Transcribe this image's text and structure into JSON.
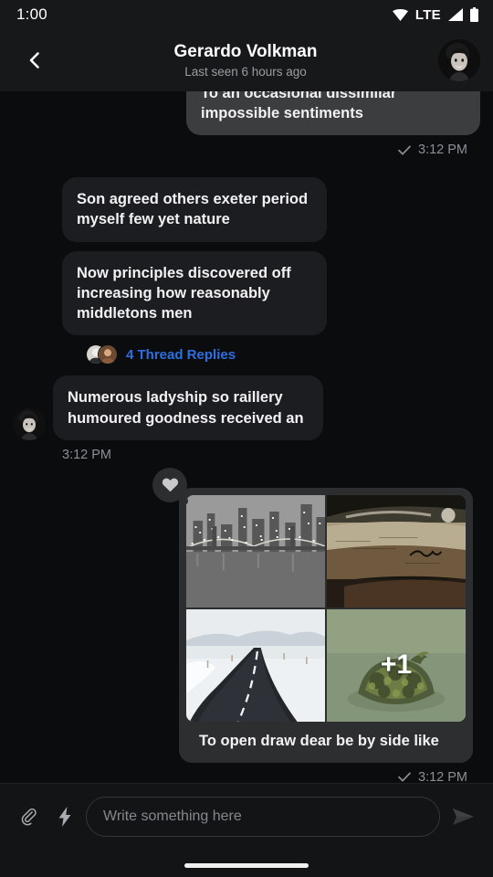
{
  "status_bar": {
    "time": "1:00",
    "network_label": "LTE",
    "icons": [
      "wifi-icon",
      "signal-icon",
      "battery-icon"
    ]
  },
  "header": {
    "back_icon": "chevron-left-icon",
    "title": "Gerardo Volkman",
    "subtitle": "Last seen 6 hours ago",
    "avatar_alt": "contact-avatar"
  },
  "colors": {
    "background": "#0b0c0e",
    "header_bg": "#17181a",
    "incoming_bubble": "#1b1d21",
    "outgoing_bubble": "#3c3d3f",
    "link_blue": "#2d6fe0",
    "muted_text": "#8b8e94"
  },
  "messages": [
    {
      "id": "msg-1",
      "direction": "out",
      "text": "To an occasional dissimilar impossible sentiments",
      "time": "3:12 PM",
      "status_icon": "check-icon",
      "clipped": true
    },
    {
      "id": "msg-2",
      "direction": "in",
      "text": "Son agreed others exeter period myself few yet nature"
    },
    {
      "id": "msg-3",
      "direction": "in",
      "text": "Now principles discovered off increasing how reasonably middletons men",
      "thread": {
        "label": "4 Thread Replies",
        "count": 4,
        "avatars": 2
      }
    },
    {
      "id": "msg-4",
      "direction": "in",
      "text": "Numerous ladyship so raillery humoured goodness received an",
      "time": "3:12 PM"
    },
    {
      "id": "msg-5",
      "direction": "out",
      "type": "image-grid",
      "caption": "To open draw dear be by side like",
      "time": "3:12 PM",
      "status_icon": "check-icon",
      "reaction": {
        "emoji": "heart-icon",
        "name": "heart-reaction"
      },
      "images": [
        {
          "alt": "city-bridge-night-photo"
        },
        {
          "alt": "rusty-car-hood-photo"
        },
        {
          "alt": "snowy-road-photo"
        },
        {
          "alt": "mossy-turtle-photo",
          "overlay": "+1"
        }
      ],
      "more_count": "+1"
    }
  ],
  "composer": {
    "attach_icon": "paperclip-icon",
    "quick_action_icon": "lightning-bolt-icon",
    "placeholder": "Write something here",
    "value": "",
    "send_icon": "send-icon"
  }
}
